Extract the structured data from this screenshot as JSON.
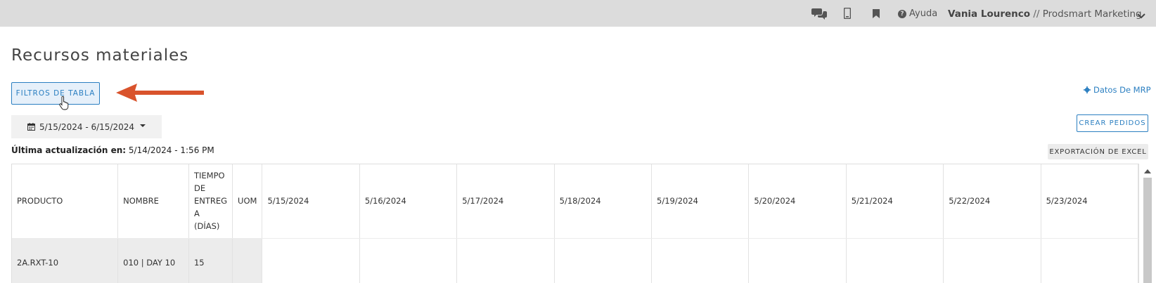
{
  "topbar": {
    "icons": [
      "chat-icon",
      "mobile-icon",
      "bookmark-icon"
    ],
    "help_label": "Ayuda",
    "user_name": "Vania Lourenco",
    "separator": "//",
    "company": "Prodsmart Marketing"
  },
  "page": {
    "title": "Recursos materiales"
  },
  "toolbar": {
    "filters_label": "FILTROS DE TABLA",
    "mrp_label": "Datos De MRP",
    "date_range": "5/15/2024 - 6/15/2024",
    "create_orders_label": "CREAR PEDIDOS",
    "excel_export_label": "EXPORTACIÓN DE EXCEL",
    "last_update_label": "Última actualización en:",
    "last_update_value": "5/14/2024 - 1:56 PM"
  },
  "table": {
    "headers": {
      "product": "PRODUCTO",
      "name": "NOMBRE",
      "lead_time": [
        "TIEMPO",
        "DE",
        "ENTREG",
        "A",
        "(DÍAS)"
      ],
      "uom": "UOM",
      "dates": [
        "5/15/2024",
        "5/16/2024",
        "5/17/2024",
        "5/18/2024",
        "5/19/2024",
        "5/20/2024",
        "5/21/2024",
        "5/22/2024",
        "5/23/2024"
      ]
    },
    "rows": [
      {
        "product": "2A.RXT-10",
        "name": "010 | DAY 10",
        "lead_time": "15",
        "uom": ""
      }
    ]
  },
  "colors": {
    "accent": "#2b7fc1",
    "annotation_arrow": "#d9532c",
    "topbar_bg": "#dcdcdc"
  }
}
